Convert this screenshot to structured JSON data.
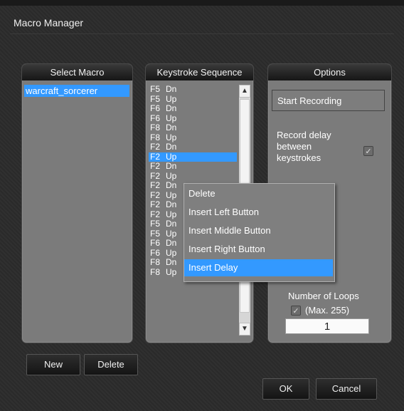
{
  "window": {
    "title": "Macro Manager"
  },
  "select_macro": {
    "header": "Select Macro",
    "items": [
      "warcraft_sorcerer"
    ]
  },
  "keystroke_sequence": {
    "header": "Keystroke Sequence",
    "rows": [
      {
        "key": "F5",
        "action": "Dn"
      },
      {
        "key": "F5",
        "action": "Up"
      },
      {
        "key": "F6",
        "action": "Dn"
      },
      {
        "key": "F6",
        "action": "Up"
      },
      {
        "key": "F8",
        "action": "Dn"
      },
      {
        "key": "F8",
        "action": "Up"
      },
      {
        "key": "F2",
        "action": "Dn"
      },
      {
        "key": "F2",
        "action": "Up"
      },
      {
        "key": "F2",
        "action": "Dn"
      },
      {
        "key": "F2",
        "action": "Up"
      },
      {
        "key": "F2",
        "action": "Dn"
      },
      {
        "key": "F2",
        "action": "Up"
      },
      {
        "key": "F2",
        "action": "Dn"
      },
      {
        "key": "F2",
        "action": "Up"
      },
      {
        "key": "F5",
        "action": "Dn"
      },
      {
        "key": "F5",
        "action": "Up"
      },
      {
        "key": "F6",
        "action": "Dn"
      },
      {
        "key": "F6",
        "action": "Up"
      },
      {
        "key": "F8",
        "action": "Dn"
      },
      {
        "key": "F8",
        "action": "Up"
      }
    ],
    "selected_index": 7
  },
  "options": {
    "header": "Options",
    "start_recording": "Start Recording",
    "record_delay_label": "Record delay between keystrokes",
    "record_delay_checked": true,
    "loops_label": "Number of Loops",
    "loops_max": "(Max. 255)",
    "loops_checked": true,
    "loops_value": "1"
  },
  "context_menu": {
    "items": [
      "Delete",
      "Insert Left Button",
      "Insert Middle Button",
      "Insert Right Button",
      "Insert Delay"
    ],
    "active_index": 4
  },
  "buttons": {
    "new": "New",
    "delete": "Delete",
    "ok": "OK",
    "cancel": "Cancel"
  },
  "colors": {
    "selection": "#3399ff",
    "panel": "#7b7b7b",
    "background": "#2b2b2b"
  }
}
